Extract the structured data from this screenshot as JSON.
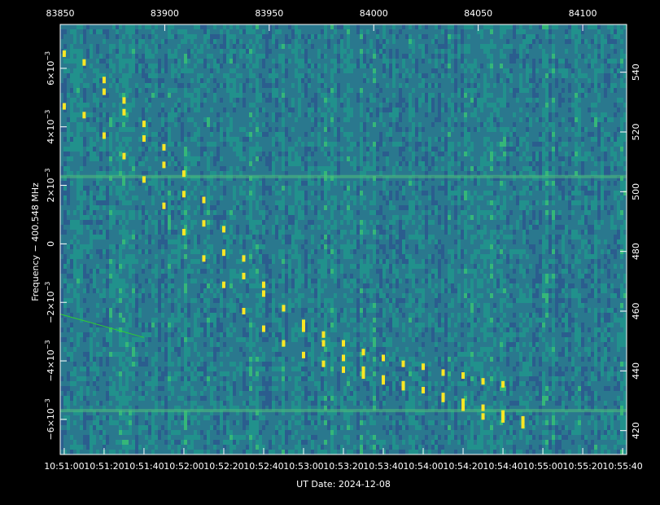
{
  "chart_data": {
    "type": "heatmap",
    "title": "",
    "xlabel": "UT Date: 2024-12-08",
    "ylabel": "Frequency − 400.548 MHz",
    "x_bottom_ticks": [
      "10:51:00",
      "10:51:20",
      "10:51:40",
      "10:52:00",
      "10:52:20",
      "10:52:40",
      "10:53:00",
      "10:53:20",
      "10:53:40",
      "10:54:00",
      "10:54:20",
      "10:54:40",
      "10:55:00",
      "10:55:20",
      "10:55:40"
    ],
    "x_top_ticks": [
      "83850",
      "83900",
      "83950",
      "84000",
      "84050",
      "84100"
    ],
    "y_left_ticks": [
      {
        "mant": "6×10",
        "exp": "−3"
      },
      {
        "mant": "4×10",
        "exp": "−3"
      },
      {
        "mant": "2×10",
        "exp": "−3"
      },
      {
        "mant": "0",
        "exp": ""
      },
      {
        "mant": "−2×10",
        "exp": "−3"
      },
      {
        "mant": "−4×10",
        "exp": "−3"
      },
      {
        "mant": "−6×10",
        "exp": "−3"
      }
    ],
    "y_left_values": [
      0.006,
      0.004,
      0.002,
      0,
      -0.002,
      -0.004,
      -0.006
    ],
    "y_right_ticks": [
      "540",
      "520",
      "500",
      "480",
      "460",
      "440",
      "420"
    ],
    "y_right_values": [
      540,
      520,
      500,
      480,
      460,
      440,
      420
    ],
    "x_range_s": [
      -2,
      282
    ],
    "y_range_MHz": [
      -0.0072,
      0.0075
    ],
    "y_right_range": [
      412,
      556
    ],
    "x_top_range": [
      83850,
      84121
    ],
    "background_colors": [
      "#2b5d8e",
      "#2a788e",
      "#21918c",
      "#35b779"
    ],
    "signal_color": "#fde725",
    "signal_tracks": [
      {
        "name": "upper",
        "points": [
          [
            0,
            0.0065
          ],
          [
            10,
            0.0062
          ],
          [
            20,
            0.0056
          ],
          [
            30,
            0.0049
          ],
          [
            40,
            0.0041
          ],
          [
            50,
            0.0033
          ],
          [
            60,
            0.0024
          ],
          [
            70,
            0.0015
          ],
          [
            80,
            0.0005
          ],
          [
            90,
            -0.0005
          ],
          [
            100,
            -0.0014
          ],
          [
            110,
            -0.0022
          ],
          [
            120,
            -0.0029
          ],
          [
            130,
            -0.0034
          ],
          [
            140,
            -0.0039
          ],
          [
            150,
            -0.0043
          ],
          [
            160,
            -0.0046
          ],
          [
            170,
            -0.0048
          ],
          [
            180,
            -0.005
          ],
          [
            190,
            -0.0053
          ],
          [
            200,
            -0.0056
          ],
          [
            210,
            -0.0059
          ],
          [
            220,
            -0.006
          ],
          [
            230,
            -0.0062
          ]
        ]
      },
      {
        "name": "lower",
        "points": [
          [
            0,
            0.0047
          ],
          [
            10,
            0.0044
          ],
          [
            20,
            0.0037
          ],
          [
            30,
            0.003
          ],
          [
            40,
            0.0022
          ],
          [
            50,
            0.0013
          ],
          [
            60,
            0.0004
          ],
          [
            70,
            -0.0005
          ],
          [
            80,
            -0.0014
          ],
          [
            90,
            -0.0023
          ],
          [
            100,
            -0.0029
          ],
          [
            110,
            -0.0034
          ],
          [
            120,
            -0.0038
          ],
          [
            130,
            -0.0041
          ],
          [
            140,
            -0.0043
          ],
          [
            150,
            -0.0045
          ],
          [
            160,
            -0.0047
          ],
          [
            170,
            -0.0049
          ],
          [
            180,
            -0.005
          ],
          [
            190,
            -0.0052
          ],
          [
            200,
            -0.0054
          ],
          [
            210,
            -0.0056
          ],
          [
            220,
            -0.0058
          ],
          [
            230,
            -0.006
          ]
        ]
      },
      {
        "name": "middle",
        "points": [
          [
            20,
            0.0052
          ],
          [
            30,
            0.0045
          ],
          [
            40,
            0.0036
          ],
          [
            50,
            0.0027
          ],
          [
            60,
            0.0017
          ],
          [
            70,
            0.0007
          ],
          [
            80,
            -0.0003
          ],
          [
            90,
            -0.0011
          ],
          [
            100,
            -0.0017
          ],
          [
            110,
            -0.0022
          ],
          [
            120,
            -0.0027
          ],
          [
            130,
            -0.0031
          ],
          [
            140,
            -0.0034
          ],
          [
            150,
            -0.0037
          ],
          [
            160,
            -0.0039
          ],
          [
            170,
            -0.0041
          ],
          [
            180,
            -0.0042
          ],
          [
            190,
            -0.0044
          ],
          [
            200,
            -0.0045
          ],
          [
            210,
            -0.0047
          ],
          [
            220,
            -0.0048
          ]
        ]
      }
    ],
    "horizontal_bands_MHz": [
      0.0023,
      -0.0057
    ],
    "green_line": {
      "color": "#2fcf2f",
      "points": [
        [
          -2,
          -0.0024
        ],
        [
          40,
          -0.0032
        ]
      ]
    }
  }
}
